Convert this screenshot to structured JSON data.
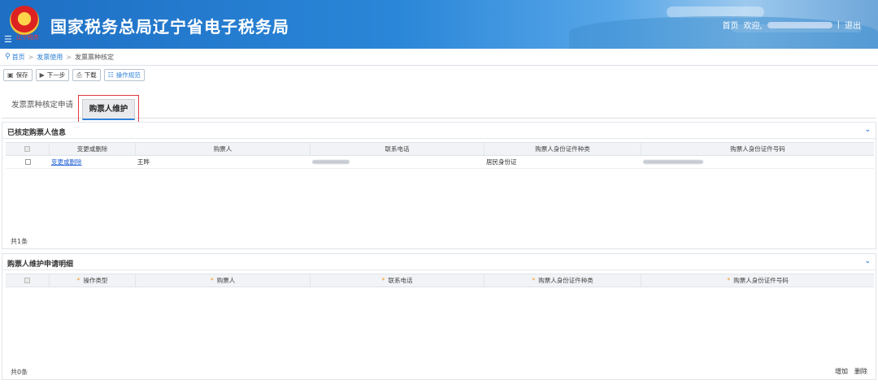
{
  "header": {
    "seal_text": "辽宁税务",
    "site_title": "国家税务总局辽宁省电子税务局",
    "nav_home": "首页",
    "nav_welcome": "欢迎,",
    "nav_sep": "|",
    "nav_logout": "退出"
  },
  "breadcrumb": {
    "items": [
      "首页",
      "发票使用",
      "发票票种核定"
    ],
    "sep": ">"
  },
  "toolbar": {
    "save": "保存",
    "next": "下一步",
    "download": "下载",
    "guide": "操作规范"
  },
  "tabs": {
    "tab1": "发票票种核定申请",
    "tab2": "购票人维护"
  },
  "panel1": {
    "title": "已核定购票人信息",
    "headers": [
      "变更或删除",
      "购票人",
      "联系电话",
      "购票人身份证件种类",
      "购票人身份证件号码"
    ],
    "rows": [
      {
        "action": "变更或删除",
        "buyer": "王晔",
        "id_type": "居民身份证"
      }
    ],
    "count": "共1条"
  },
  "panel2": {
    "title": "购票人维护申请明细",
    "headers": [
      "操作类型",
      "购票人",
      "联系电话",
      "购票人身份证件种类",
      "购票人身份证件号码"
    ],
    "required_mark": "*",
    "count": "共0条",
    "add": "增加",
    "delete": "删除"
  },
  "icons": [
    "menu-icon",
    "pin-icon",
    "save-icon",
    "next-icon",
    "download-icon",
    "guide-icon",
    "chevron-down-icon"
  ],
  "colors": {
    "brand_blue": "#2f80d6",
    "highlight_red": "#e0383e",
    "required_orange": "#f39c2b"
  }
}
